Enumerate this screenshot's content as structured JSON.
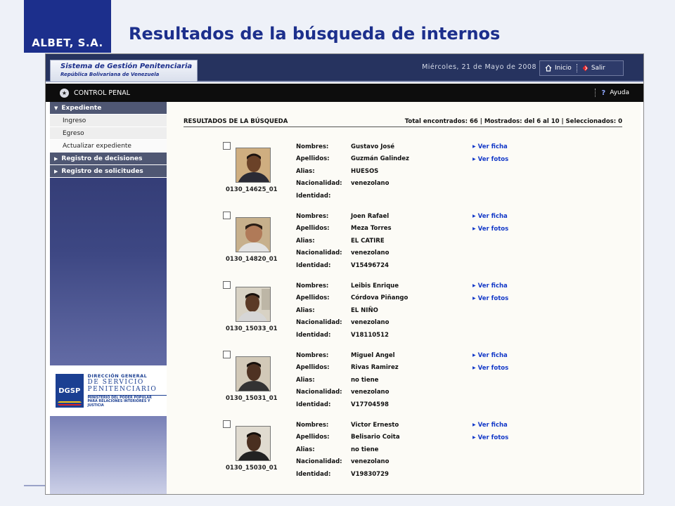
{
  "slide": {
    "logo": "ALBET, S.A.",
    "title": "Resultados de la búsqueda de internos"
  },
  "app": {
    "brand_title": "Sistema de Gestión Penitenciaria",
    "brand_subtitle": "República Bolivariana de Venezuela",
    "date": "Miércoles, 21 de Mayo de 2008",
    "nav_inicio": "Inicio",
    "nav_salir": "Salir",
    "section": "CONTROL PENAL",
    "help": "Ayuda"
  },
  "sidebar": {
    "items": [
      {
        "label": "Expediente",
        "type": "head",
        "arrow": "▼"
      },
      {
        "label": "Ingreso",
        "type": "sub"
      },
      {
        "label": "Egreso",
        "type": "sub"
      },
      {
        "label": "Actualizar expediente",
        "type": "sub"
      },
      {
        "label": "Registro de decisiones",
        "type": "head",
        "arrow": "▶"
      },
      {
        "label": "Registro de solicitudes",
        "type": "head",
        "arrow": "▶"
      }
    ],
    "dgsp": {
      "badge": "DGSP",
      "line1": "DIRECCIÓN GENERAL",
      "line2": "DE SERVICIO",
      "line3": "PENITENCIARIO",
      "line4": "MINISTERIO DEL PODER POPULAR",
      "line5": "PARA RELACIONES INTERIORES Y JUSTICIA"
    }
  },
  "results": {
    "heading": "RESULTADOS DE LA BÚSQUEDA",
    "summary": "Total encontrados: 66 | Mostrados: del 6 al 10 | Seleccionados: 0",
    "labels": {
      "nombres": "Nombres:",
      "apellidos": "Apellidos:",
      "alias": "Alias:",
      "nacionalidad": "Nacionalidad:",
      "identidad": "Identidad:"
    },
    "link_ficha": "Ver ficha",
    "link_fotos": "Ver fotos",
    "entries": [
      {
        "code": "0130_14625_01",
        "nombres": "Gustavo José",
        "apellidos": "Guzmán Galindez",
        "alias": "HUESOS",
        "nacionalidad": "venezolano",
        "identidad": ""
      },
      {
        "code": "0130_14820_01",
        "nombres": "Joen Rafael",
        "apellidos": "Meza Torres",
        "alias": "EL CATIRE",
        "nacionalidad": "venezolano",
        "identidad": "V15496724"
      },
      {
        "code": "0130_15033_01",
        "nombres": "Leibis Enrique",
        "apellidos": "Córdova Piñango",
        "alias": "EL NIÑO",
        "nacionalidad": "venezolano",
        "identidad": "V18110512"
      },
      {
        "code": "0130_15031_01",
        "nombres": "Miguel Angel",
        "apellidos": "Rivas Ramirez",
        "alias": "no tiene",
        "nacionalidad": "venezolano",
        "identidad": "V17704598"
      },
      {
        "code": "0130_15030_01",
        "nombres": "Victor Ernesto",
        "apellidos": "Belisario Coita",
        "alias": "no tiene",
        "nacionalidad": "venezolano",
        "identidad": "V19830729"
      }
    ]
  }
}
